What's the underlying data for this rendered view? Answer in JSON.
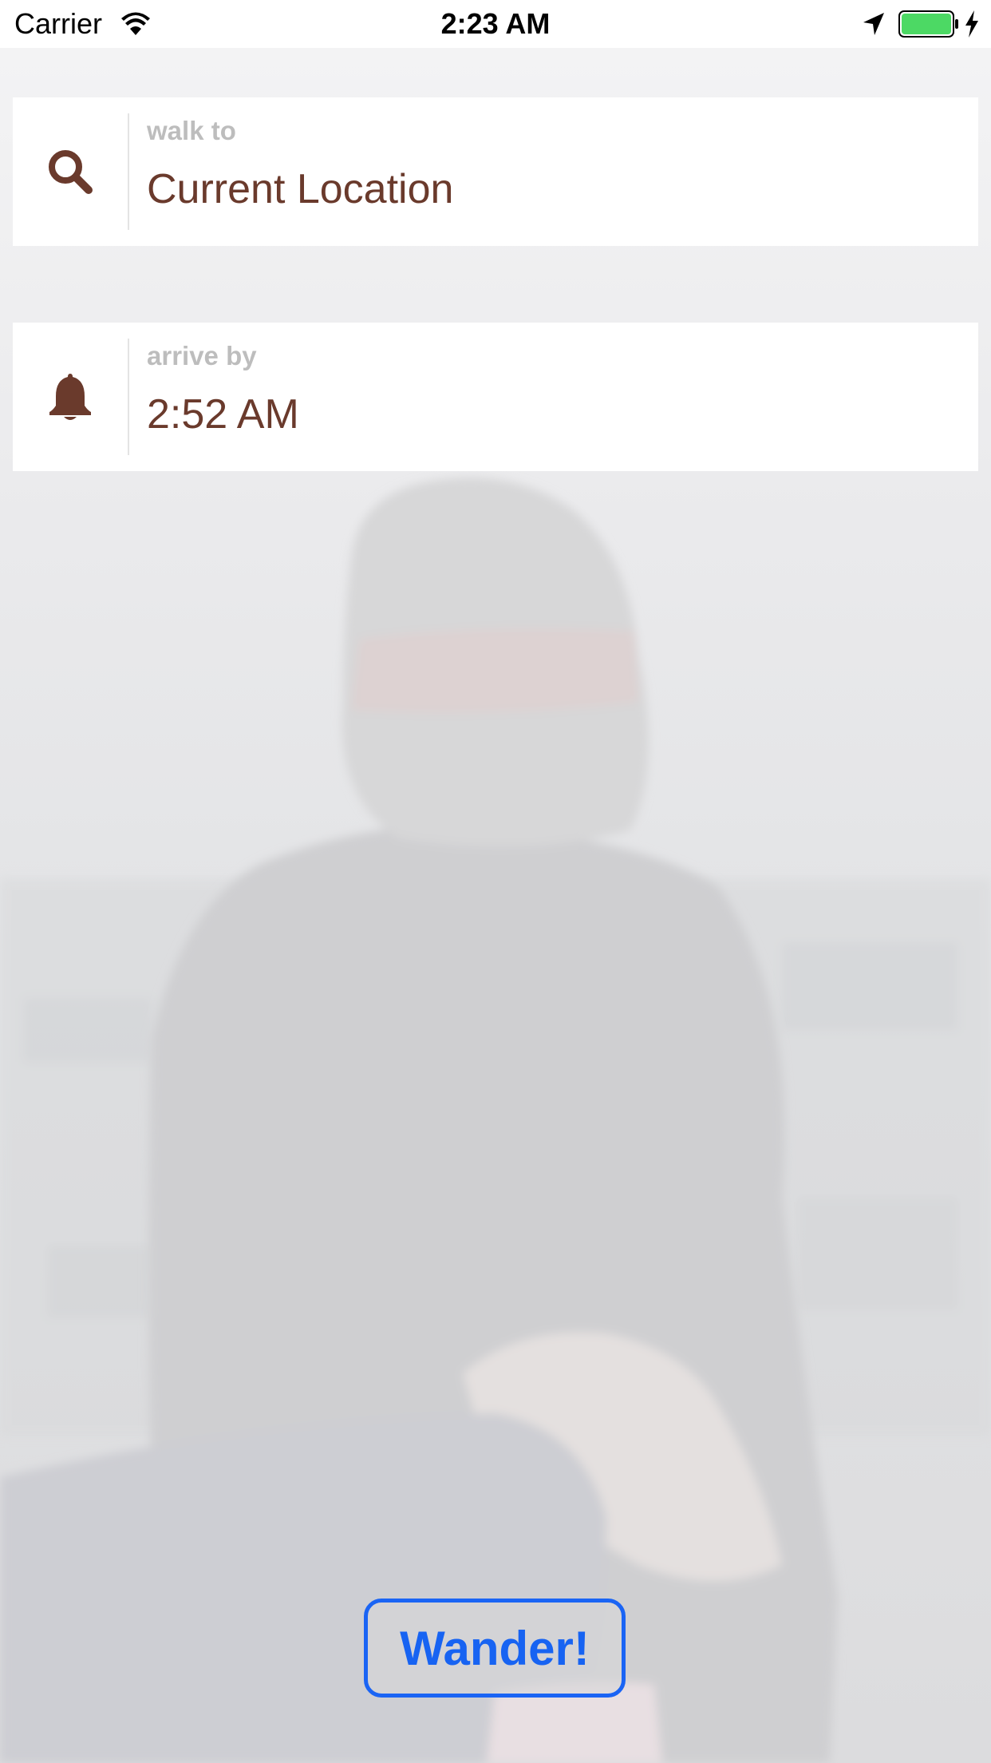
{
  "status_bar": {
    "carrier": "Carrier",
    "time": "2:23 AM",
    "icons": [
      "wifi-icon",
      "location-arrow-icon",
      "battery-icon",
      "charging-bolt-icon"
    ],
    "battery_color": "#4cd964"
  },
  "destination": {
    "label": "walk to",
    "value": "Current Location",
    "icon": "search-icon"
  },
  "arrival": {
    "label": "arrive by",
    "value": "2:52 AM",
    "icon": "bell-icon"
  },
  "action": {
    "label": "Wander!"
  },
  "colors": {
    "accent": "#1a64f4",
    "value_text": "#6a3a2c",
    "label_text": "#bdbdbd"
  }
}
